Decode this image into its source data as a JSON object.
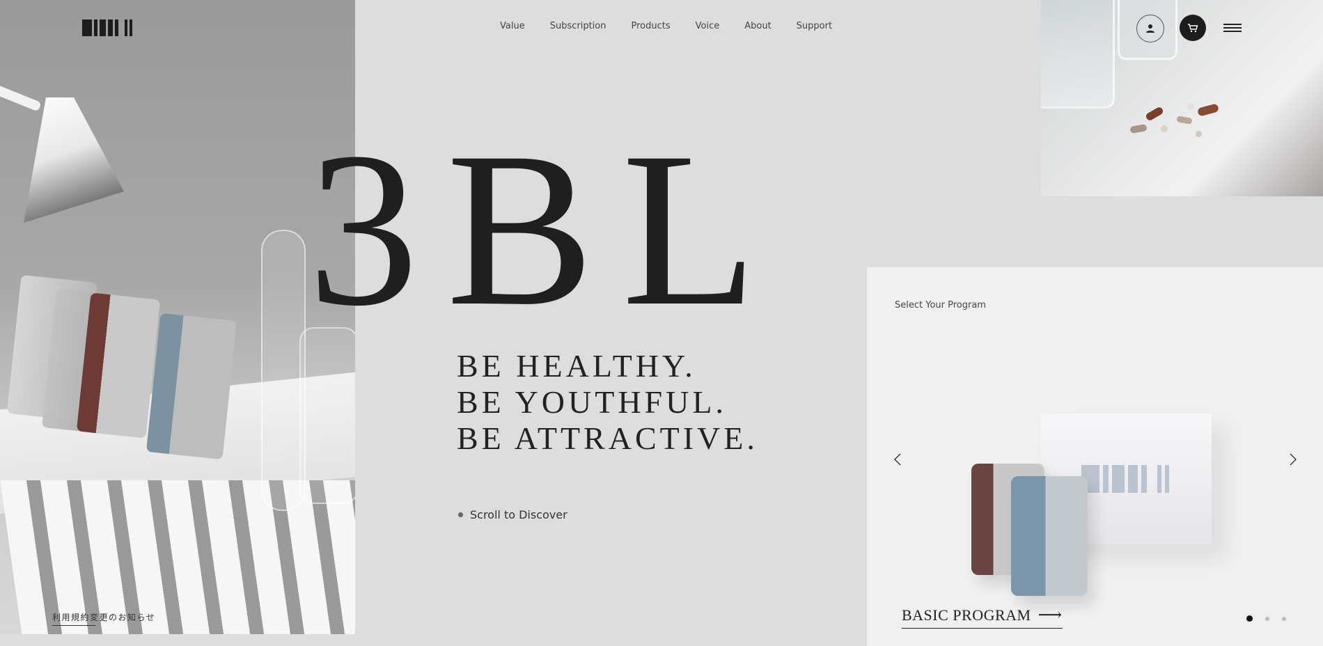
{
  "header": {
    "logo_alt": "3BL logo",
    "nav": [
      "Value",
      "Subscription",
      "Products",
      "Voice",
      "About",
      "Support"
    ],
    "icons": [
      "user-icon",
      "cart-icon",
      "menu-icon"
    ]
  },
  "hero": {
    "title": "3BL",
    "tagline": [
      "BE HEALTHY.",
      "BE YOUTHFUL.",
      "BE ATTRACTIVE."
    ],
    "scroll_text": "Scroll to Discover"
  },
  "program": {
    "label": "Select Your Program",
    "name": "BASIC PROGRAM",
    "arrow": "⟶",
    "pager": {
      "total": 3,
      "active": 1
    }
  },
  "footer": {
    "notice": "利用規約変更のお知らせ"
  },
  "colors": {
    "background": "#dddddd",
    "card": "#f0f0f0",
    "ink": "#1f1f1f",
    "accent_brown": "#6b4541",
    "accent_blue": "#7b95aa"
  }
}
